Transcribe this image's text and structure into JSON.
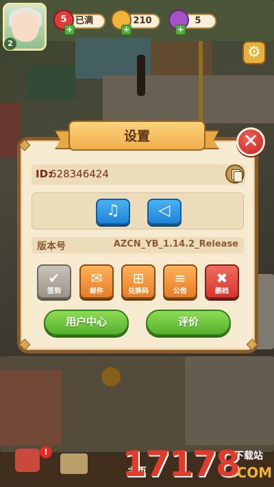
{
  "hud": {
    "level": "2",
    "hearts": {
      "count": "5",
      "status": "已满"
    },
    "coins": "210",
    "gems": "5",
    "plus": "+"
  },
  "dialog": {
    "title": "设置",
    "close": "✕",
    "id_label": "ID:",
    "id_value": "628346424",
    "music_glyph": "♫",
    "sound_glyph": "◁",
    "version_label": "版本号",
    "version_value": "AZCN_YB_1.14.2_Release",
    "tiles": [
      {
        "label": "签到",
        "glyph": "✔"
      },
      {
        "label": "邮件",
        "glyph": "✉"
      },
      {
        "label": "兑换码",
        "glyph": "⊞"
      },
      {
        "label": "公告",
        "glyph": "≡"
      },
      {
        "label": "删档",
        "glyph": "✖"
      }
    ],
    "user_center": "用户中心",
    "rate": "评价"
  },
  "gear_glyph": "⚙",
  "bottom": {
    "alert": "!",
    "home_label": "主页"
  },
  "watermark": {
    "logo": "17178",
    "site": "下载站",
    "com": ".COM"
  },
  "colors": {
    "dialog_frame": "#8a5a2c",
    "dialog_fill": "#f6ead0",
    "green_button": "#55b12c",
    "blue_button": "#1f83d6",
    "close_red": "#c5251f",
    "tile_orange": "#ea7c26",
    "tile_red": "#d6352b",
    "tile_gray": "#9c948a"
  }
}
